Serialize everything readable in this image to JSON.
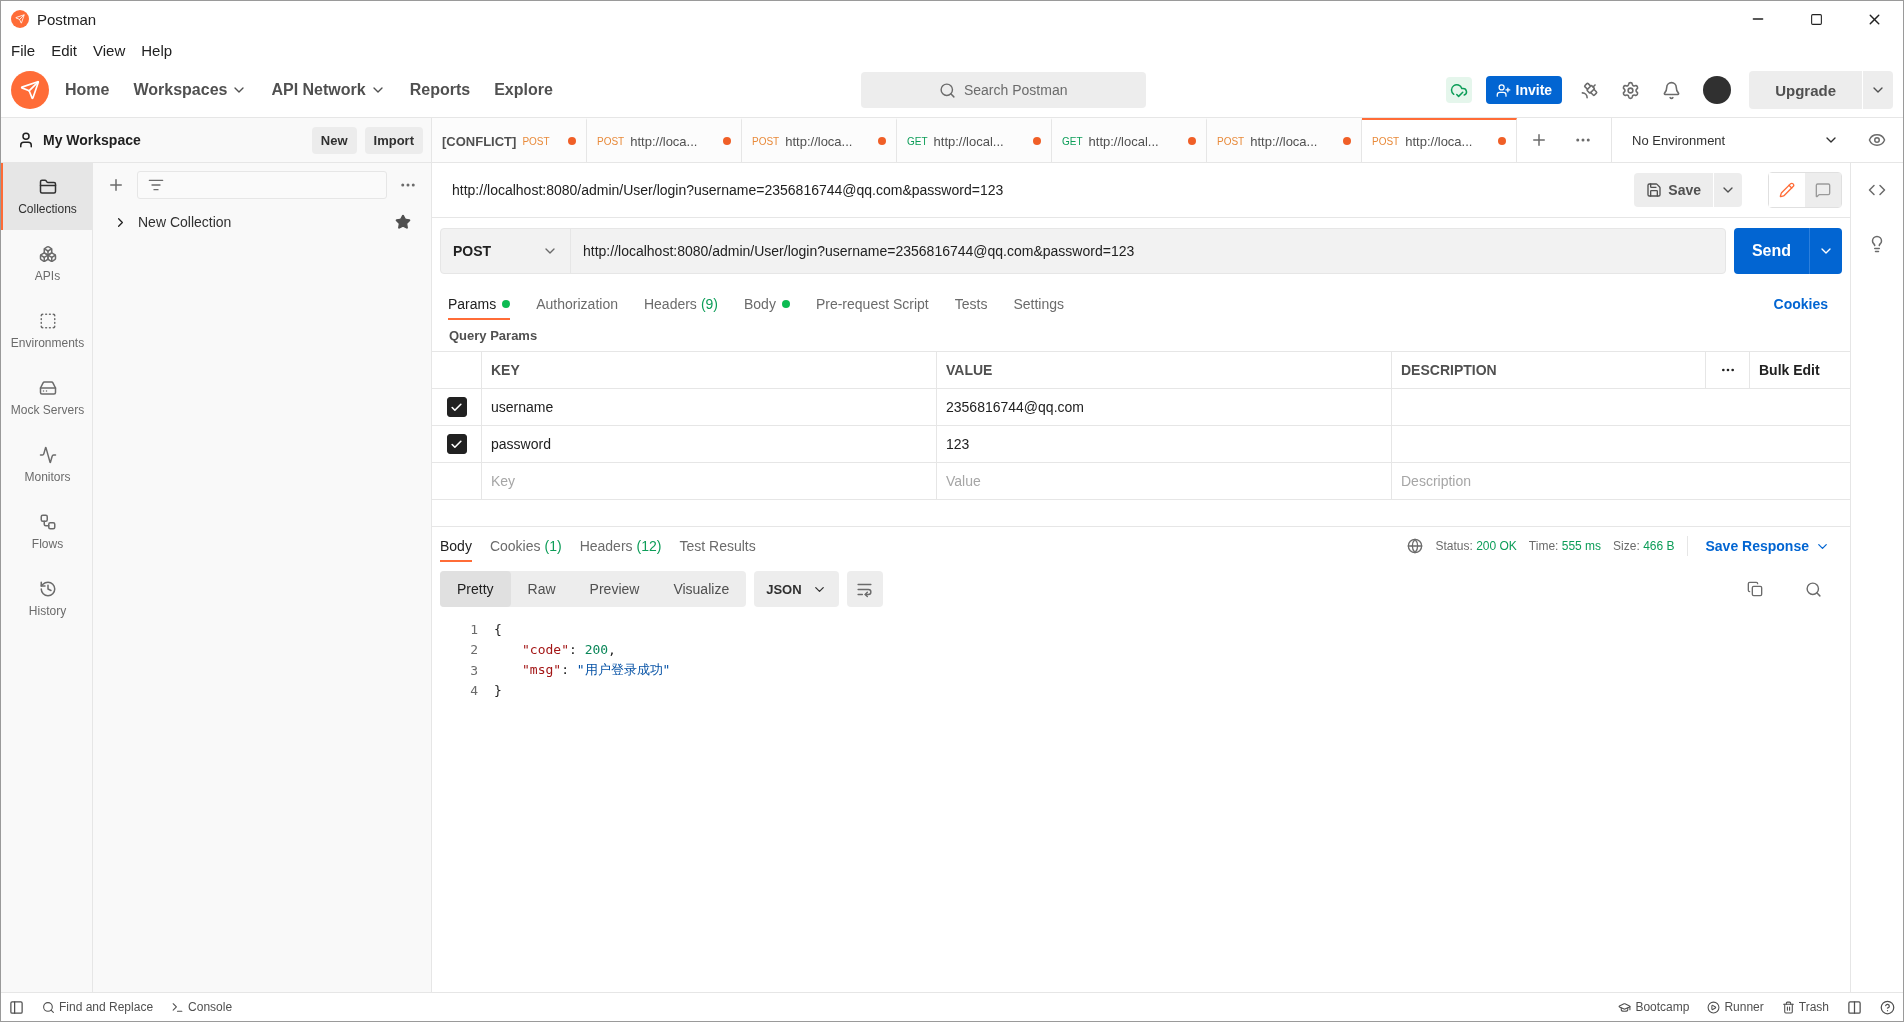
{
  "window": {
    "title": "Postman"
  },
  "menu": [
    "File",
    "Edit",
    "View",
    "Help"
  ],
  "nav": [
    {
      "label": "Home",
      "dropdown": false
    },
    {
      "label": "Workspaces",
      "dropdown": true
    },
    {
      "label": "API Network",
      "dropdown": true
    },
    {
      "label": "Reports",
      "dropdown": false
    },
    {
      "label": "Explore",
      "dropdown": false
    }
  ],
  "search": {
    "placeholder": "Search Postman"
  },
  "header_actions": {
    "invite": "Invite",
    "upgrade": "Upgrade"
  },
  "workspace": {
    "name": "My Workspace",
    "new": "New",
    "import": "Import"
  },
  "rail": [
    {
      "label": "Collections",
      "selected": true
    },
    {
      "label": "APIs",
      "selected": false
    },
    {
      "label": "Environments",
      "selected": false
    },
    {
      "label": "Mock Servers",
      "selected": false
    },
    {
      "label": "Monitors",
      "selected": false
    },
    {
      "label": "Flows",
      "selected": false
    },
    {
      "label": "History",
      "selected": false
    }
  ],
  "collections": [
    {
      "name": "New Collection",
      "expanded": false,
      "starred": true
    }
  ],
  "tabs": [
    {
      "prefix": "[CONFLICT]",
      "method": "POST",
      "color": "#e88a3a",
      "unsaved": true,
      "selected": false
    },
    {
      "method": "POST",
      "title": "http://loca...",
      "color": "#e88a3a",
      "unsaved": true,
      "selected": false
    },
    {
      "method": "POST",
      "title": "http://loca...",
      "color": "#e88a3a",
      "unsaved": true,
      "selected": false
    },
    {
      "method": "GET",
      "title": "http://local...",
      "color": "#0c9d58",
      "unsaved": true,
      "selected": false
    },
    {
      "method": "GET",
      "title": "http://local...",
      "color": "#0c9d58",
      "unsaved": true,
      "selected": false
    },
    {
      "method": "POST",
      "title": "http://loca...",
      "color": "#e88a3a",
      "unsaved": true,
      "selected": false
    },
    {
      "method": "POST",
      "title": "http://loca...",
      "color": "#e88a3a",
      "unsaved": true,
      "selected": true
    }
  ],
  "environment": "No Environment",
  "request": {
    "name": "http://localhost:8080/admin/User/login?username=2356816744@qq.com&password=123",
    "save": "Save",
    "method": "POST",
    "url": "http://localhost:8080/admin/User/login?username=2356816744@qq.com&password=123",
    "send": "Send"
  },
  "request_tabs": [
    {
      "label": "Params",
      "dot": true,
      "selected": true
    },
    {
      "label": "Authorization",
      "dot": false,
      "selected": false
    },
    {
      "label": "Headers",
      "count": "(9)",
      "dot": false,
      "selected": false
    },
    {
      "label": "Body",
      "dot": true,
      "selected": false
    },
    {
      "label": "Pre-request Script",
      "dot": false,
      "selected": false
    },
    {
      "label": "Tests",
      "dot": false,
      "selected": false
    },
    {
      "label": "Settings",
      "dot": false,
      "selected": false
    }
  ],
  "cookies_link": "Cookies",
  "params": {
    "title": "Query Params",
    "columns": [
      "KEY",
      "VALUE",
      "DESCRIPTION"
    ],
    "bulk_edit": "Bulk Edit",
    "rows": [
      {
        "key": "username",
        "value": "2356816744@qq.com",
        "checked": true
      },
      {
        "key": "password",
        "value": "123",
        "checked": true
      }
    ],
    "new_row": [
      {
        "placeholder": "Key"
      },
      {
        "placeholder": "Value"
      },
      {
        "placeholder": "Description"
      }
    ]
  },
  "response_tabs": [
    {
      "label": "Body",
      "selected": true
    },
    {
      "label": "Cookies",
      "count": "(1)",
      "selected": false
    },
    {
      "label": "Headers",
      "count": "(12)",
      "selected": false
    },
    {
      "label": "Test Results",
      "selected": false
    }
  ],
  "response_meta": [
    {
      "label": "Status:",
      "value": "200 OK"
    },
    {
      "label": "Time:",
      "value": "555 ms"
    },
    {
      "label": "Size:",
      "value": "466 B"
    }
  ],
  "save_response": "Save Response",
  "view_modes": [
    {
      "label": "Pretty",
      "selected": true
    },
    {
      "label": "Raw",
      "selected": false
    },
    {
      "label": "Preview",
      "selected": false
    },
    {
      "label": "Visualize",
      "selected": false
    }
  ],
  "format": "JSON",
  "code": [
    {
      "number": "1",
      "tokens": [
        {
          "kind": "punct",
          "text": "{"
        }
      ]
    },
    {
      "number": "2",
      "tokens": [
        {
          "kind": "key",
          "text": "\"code\""
        },
        {
          "kind": "punct",
          "text": ": "
        },
        {
          "kind": "number",
          "text": "200"
        },
        {
          "kind": "punct",
          "text": ","
        }
      ]
    },
    {
      "number": "3",
      "tokens": [
        {
          "kind": "key",
          "text": "\"msg\""
        },
        {
          "kind": "punct",
          "text": ": "
        },
        {
          "kind": "string",
          "text": "\"用户登录成功\""
        }
      ]
    },
    {
      "number": "4",
      "tokens": [
        {
          "kind": "punct",
          "text": "}"
        }
      ]
    }
  ],
  "status_bar": {
    "left": [
      "Find and Replace",
      "Console"
    ],
    "right": [
      "Bootcamp",
      "Runner",
      "Trash"
    ]
  }
}
